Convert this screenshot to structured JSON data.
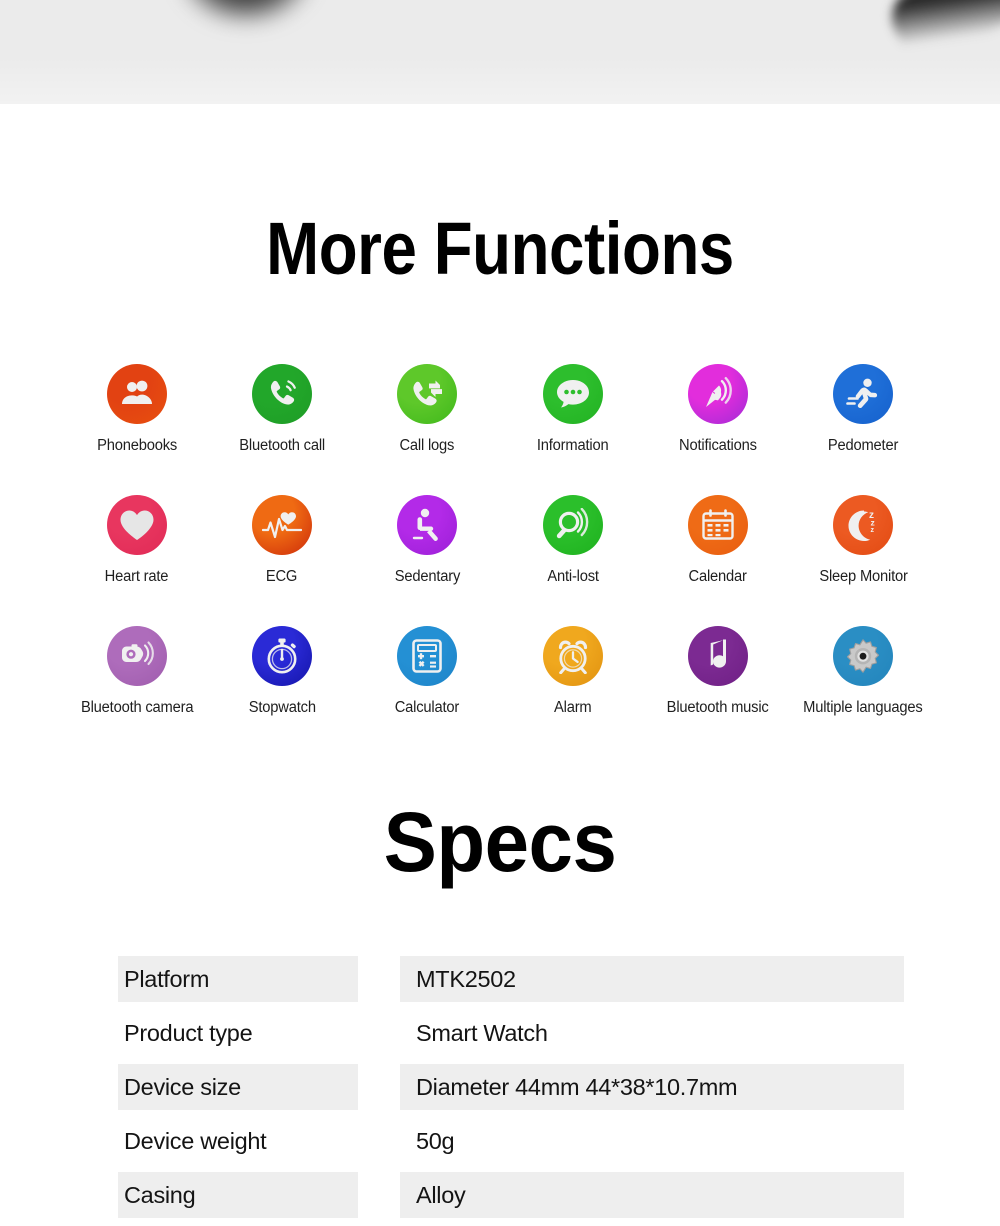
{
  "banner": {
    "kind": "product-photo-crop",
    "background": "#ebebeb"
  },
  "sections": {
    "functions_title": "More Functions",
    "specs_title": "Specs"
  },
  "features": [
    {
      "label": "Phonebooks",
      "icon": "contacts-icon",
      "color": "#e24212",
      "color2": "#e8500f"
    },
    {
      "label": "Bluetooth call",
      "icon": "phone-call-icon",
      "color": "#22a72a",
      "color2": "#1e9c26"
    },
    {
      "label": "Call logs",
      "icon": "call-logs-icon",
      "color": "#5ec82a",
      "color2": "#3fb81b"
    },
    {
      "label": "Information",
      "icon": "message-bubble-icon",
      "color": "#2dbe2d",
      "color2": "#22b222"
    },
    {
      "label": "Notifications",
      "icon": "satellite-dish-icon",
      "color": "#e22ddc",
      "color2": "#a02bd6"
    },
    {
      "label": "Pedometer",
      "icon": "running-person-icon",
      "color": "#1f6fd8",
      "color2": "#1560cc"
    },
    {
      "label": "Heart rate",
      "icon": "heart-icon",
      "color": "#e8365f",
      "color2": "#e02a56"
    },
    {
      "label": "ECG",
      "icon": "ecg-waveform-icon",
      "color": "#ef6a13",
      "color2": "#cc2a0a"
    },
    {
      "label": "Sedentary",
      "icon": "sitting-person-icon",
      "color": "#b32ae8",
      "color2": "#9b1fd6"
    },
    {
      "label": "Anti-lost",
      "icon": "magnifier-signal-icon",
      "color": "#2bbf2b",
      "color2": "#1eb11e"
    },
    {
      "label": "Calendar",
      "icon": "calendar-icon",
      "color": "#ef6b16",
      "color2": "#e85d10"
    },
    {
      "label": "Sleep Monitor",
      "icon": "moon-zzz-icon",
      "color": "#ec5a22",
      "color2": "#e24a12"
    },
    {
      "label": "Bluetooth camera",
      "icon": "camera-icon",
      "color": "#ae6cbb",
      "color2": "#9f5cad"
    },
    {
      "label": "Stopwatch",
      "icon": "stopwatch-icon",
      "color": "#2a2ad6",
      "color2": "#1414a8"
    },
    {
      "label": "Calculator",
      "icon": "calculator-icon",
      "color": "#2490d4",
      "color2": "#1e84c8"
    },
    {
      "label": "Alarm",
      "icon": "alarm-clock-icon",
      "color": "#f0a81e",
      "color2": "#e09110"
    },
    {
      "label": "Bluetooth music",
      "icon": "music-note-icon",
      "color": "#7c2a92",
      "color2": "#6f1f85"
    },
    {
      "label": "Multiple languages",
      "icon": "gear-icon",
      "color": "#2a8ec4",
      "color2": "#2384bb"
    }
  ],
  "specs": {
    "rows": [
      {
        "key": "Platform",
        "value": "MTK2502",
        "shaded": true
      },
      {
        "key": "Product type",
        "value": "Smart Watch",
        "shaded": false
      },
      {
        "key": "Device size",
        "value": "Diameter 44mm  44*38*10.7mm",
        "shaded": true
      },
      {
        "key": "Device weight",
        "value": "50g",
        "shaded": false
      },
      {
        "key": "Casing",
        "value": "Alloy",
        "shaded": true
      }
    ]
  }
}
